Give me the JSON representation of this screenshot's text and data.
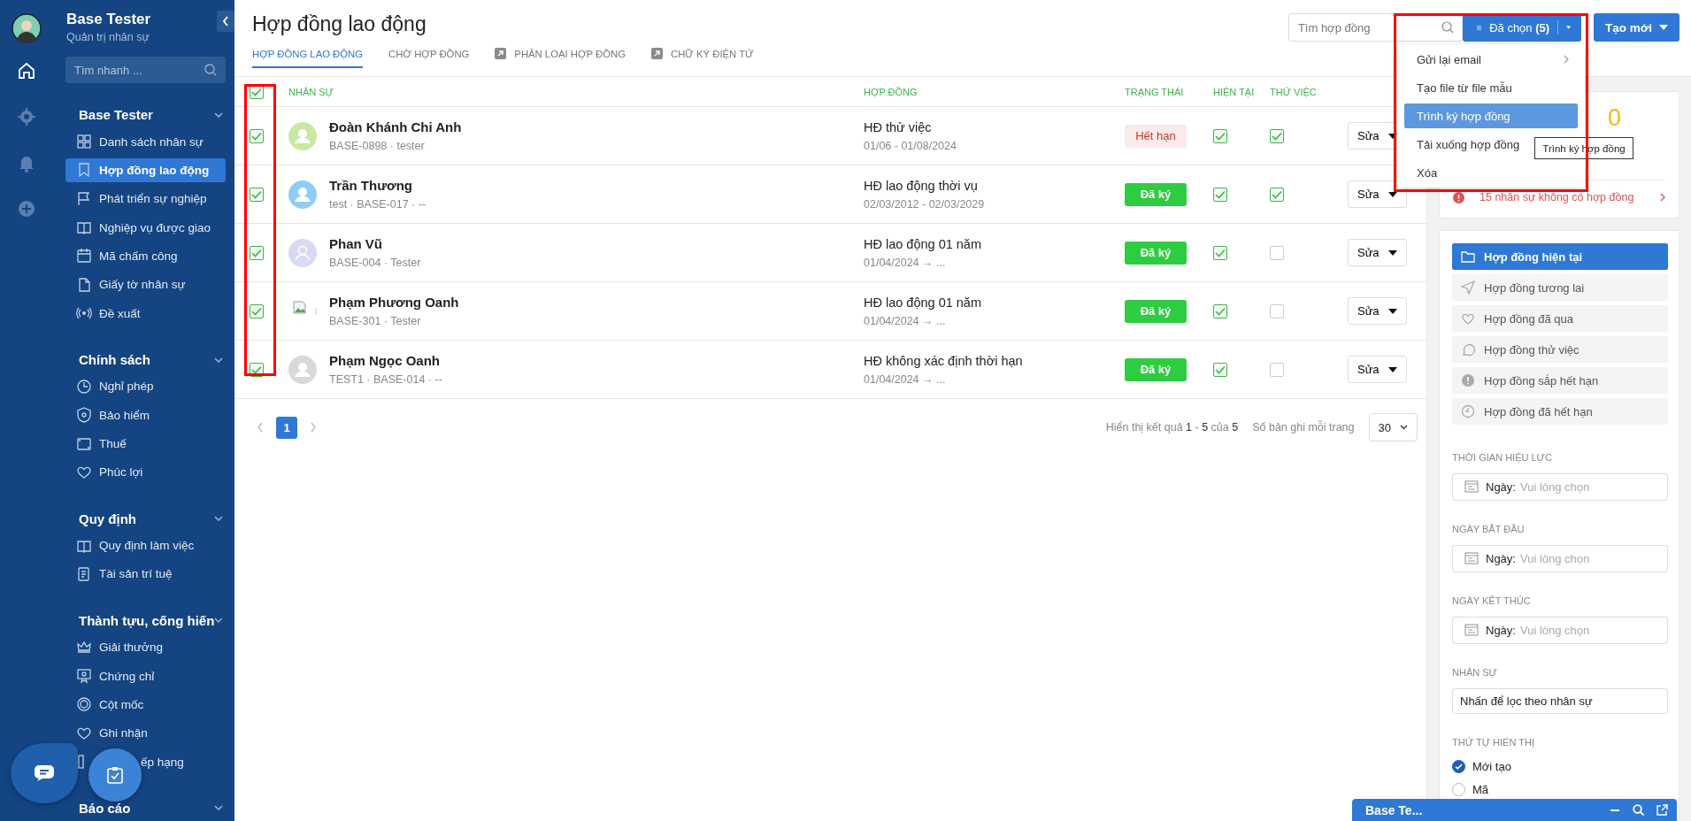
{
  "sidebar": {
    "brand": "Base Tester",
    "subtitle": "Quản trị nhân sự",
    "search_placeholder": "Tìm nhanh ...",
    "sections": [
      {
        "title": "Base Tester",
        "items": [
          {
            "label": "Danh sách nhân sự",
            "selected": false,
            "kind": "full"
          },
          {
            "label": "Hợp đồng lao động",
            "selected": true,
            "kind": "full"
          },
          {
            "label": "Phát triển sự nghiệp",
            "selected": false,
            "kind": "full"
          },
          {
            "label": "Nghiệp vụ được giao",
            "selected": false,
            "kind": "full"
          },
          {
            "label": "Mã chấm công",
            "selected": false,
            "kind": "full"
          },
          {
            "label": "Giấy tờ nhân sự",
            "selected": false,
            "kind": "full"
          },
          {
            "label": "Đề xuất",
            "selected": false,
            "kind": "full"
          }
        ]
      },
      {
        "title": "Chính sách",
        "items": [
          {
            "label": "Nghỉ phép",
            "selected": false,
            "kind": "full"
          },
          {
            "label": "Bảo hiểm",
            "selected": false,
            "kind": "full"
          },
          {
            "label": "Thuế",
            "selected": false,
            "kind": "full"
          },
          {
            "label": "Phúc lợi",
            "selected": false,
            "kind": "full"
          }
        ]
      },
      {
        "title": "Quy định",
        "items": [
          {
            "label": "Quy định làm việc",
            "selected": false,
            "kind": "full"
          },
          {
            "label": "Tài sản trí tuệ",
            "selected": false,
            "kind": "full"
          }
        ]
      },
      {
        "title": "Thành tựu, cống hiến",
        "items": [
          {
            "label": "Giải thưởng",
            "selected": false,
            "kind": "full"
          },
          {
            "label": "Chứng chỉ",
            "selected": false,
            "kind": "full"
          },
          {
            "label": "Cột mốc",
            "selected": false,
            "kind": "full"
          },
          {
            "label": "Ghi nhận",
            "selected": false,
            "kind": "full"
          },
          {
            "label": "ếp hạng",
            "selected": false,
            "kind": "covered"
          }
        ]
      },
      {
        "title": "Báo cáo"
      }
    ]
  },
  "page": {
    "title": "Hợp đồng lao động",
    "tabs": [
      {
        "label": "HỢP ĐỒNG LAO ĐỘNG",
        "selected": true,
        "kind": "plain"
      },
      {
        "label": "CHỜ HỢP ĐỒNG",
        "selected": false,
        "kind": "plain"
      },
      {
        "label": "PHÂN LOẠI HỢP ĐỒNG",
        "selected": false,
        "kind": "link"
      },
      {
        "label": "CHỮ KÝ ĐIỆN TỬ",
        "selected": false,
        "kind": "link"
      }
    ],
    "search_placeholder": "Tìm hợp đồng",
    "selected_button": "Đã chọn **(5)**",
    "create_button": "Tạo mới",
    "menu": [
      {
        "label": "Gửi lại email",
        "selected": false,
        "kind": "submenu"
      },
      {
        "label": "Tạo file từ file mẫu",
        "selected": false,
        "kind": "plain"
      },
      {
        "label": "Trình ký hợp đồng",
        "selected": true,
        "kind": "plain"
      },
      {
        "label": "Tải xuống hợp đồng",
        "selected": false,
        "kind": "plain"
      },
      {
        "label": "Xóa",
        "selected": false,
        "kind": "plain"
      }
    ],
    "tooltip": "Trình ký hợp đồng"
  },
  "table": {
    "all_checked": true,
    "columns": [
      "NHÂN SỰ",
      "HỢP ĐỒNG",
      "TRẠNG THÁI",
      "HIỆN TẠI",
      "THỬ VIỆC"
    ],
    "rows": [
      {
        "checked": true,
        "avatar": {
          "kind": "person",
          "color": "#c9e9a3"
        },
        "name": "Đoàn Khánh Chi Anh",
        "meta": "BASE-0898 · tester",
        "contract": "HĐ thử việc",
        "period": "01/06 - 01/08/2024",
        "status": {
          "label": "Hết hạn",
          "kind": "expired"
        },
        "current": true,
        "probation": true,
        "action": "Sửa"
      },
      {
        "checked": true,
        "avatar": {
          "kind": "person",
          "color": "#8fcdf7"
        },
        "name": "Trần Thương",
        "meta": "test · BASE-017 · --",
        "contract": "HĐ lao động thời vụ",
        "period": "02/03/2012 - 02/03/2029",
        "status": {
          "label": "Đã ký",
          "kind": "signed"
        },
        "current": true,
        "probation": true,
        "action": "Sửa"
      },
      {
        "checked": true,
        "avatar": {
          "kind": "outline",
          "color": "#d6daf3"
        },
        "name": "Phan Vũ",
        "meta": "BASE-004 · Tester",
        "contract": "HĐ lao động 01 năm",
        "period": "01/04/2024 → ...",
        "status": {
          "label": "Đã ký",
          "kind": "signed"
        },
        "current": true,
        "probation": false,
        "action": "Sửa"
      },
      {
        "checked": true,
        "avatar": {
          "kind": "broken"
        },
        "name": "Phạm Phương Oanh",
        "meta": "BASE-301 · Tester",
        "contract": "HĐ lao động 01 năm",
        "period": "01/04/2024 → ...",
        "status": {
          "label": "Đã ký",
          "kind": "signed"
        },
        "current": true,
        "probation": false,
        "action": "Sửa"
      },
      {
        "checked": true,
        "avatar": {
          "kind": "person",
          "color": "#d9d9d9"
        },
        "name": "Phạm Ngọc Oanh",
        "meta": "TEST1 · BASE-014 · --",
        "contract": "HĐ không xác định thời hạn",
        "period": "01/04/2024 → ...",
        "status": {
          "label": "Đã ký",
          "kind": "signed"
        },
        "current": true,
        "probation": false,
        "action": "Sửa"
      }
    ],
    "pages": [
      {
        "label": "1",
        "selected": true
      }
    ],
    "summary": "Hiển thị kết quả **1** - **5** của **5**",
    "per_page_label": "Số bản ghi mỗi trang",
    "per_page": "30"
  },
  "right_panel": {
    "stat": "0",
    "warning": "15 nhân sự không có hợp đồng",
    "nav": [
      {
        "label": "Hợp đồng hiện tại",
        "selected": true
      },
      {
        "label": "Hợp đồng tương lai",
        "selected": false
      },
      {
        "label": "Hợp đồng đã qua",
        "selected": false
      },
      {
        "label": "Hợp đồng thử việc",
        "selected": false
      },
      {
        "label": "Hợp đồng sắp hết hạn",
        "selected": false
      },
      {
        "label": "Hợp đồng đã hết hạn",
        "selected": false
      }
    ],
    "date_filters": [
      {
        "label": "THỜI GIAN HIỆU LỰC",
        "prefix": "Ngày:",
        "placeholder": "Vui lòng chọn"
      },
      {
        "label": "NGÀY BẮT ĐẦU",
        "prefix": "Ngày:",
        "placeholder": "Vui lòng chọn"
      },
      {
        "label": "NGÀY KẾT THÚC",
        "prefix": "Ngày:",
        "placeholder": "Vui lòng chọn"
      }
    ],
    "staff_filter": {
      "label": "NHÂN SỰ",
      "value": "Nhấn để lọc theo nhân sự"
    },
    "sort": {
      "label": "THỨ TỰ HIỂN THỊ",
      "options": [
        {
          "label": "Mới tạo",
          "selected": true
        },
        {
          "label": "Mã",
          "selected": false
        }
      ]
    }
  },
  "chat_widget": {
    "title": "Base Te..."
  }
}
